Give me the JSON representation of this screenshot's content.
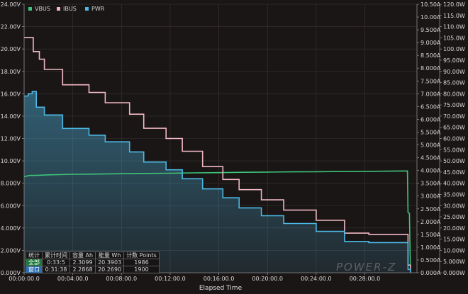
{
  "chart_data": {
    "type": "line",
    "xlabel": "Elapsed Time",
    "x_ticks": [
      "00:00:00.0",
      "00:04:00.0",
      "00:08:00.0",
      "00:12:00.0",
      "00:16:00.0",
      "00:20:00.0",
      "00:24:00.0",
      "00:28:00.0"
    ],
    "xlim_seconds": [
      0,
      1937
    ],
    "ylim_voltage": [
      0,
      24
    ],
    "ylim_current": [
      0,
      10.5
    ],
    "ylim_power": [
      0,
      120
    ],
    "y_ticks_voltage": [
      "0.000V",
      "2.000V",
      "4.000V",
      "6.000V",
      "8.000V",
      "10.00V",
      "12.00V",
      "14.00V",
      "16.00V",
      "18.00V",
      "20.00V",
      "22.00V",
      "24.00V"
    ],
    "y_ticks_current": [
      "0.000A",
      "0.500A",
      "1.000A",
      "1.500A",
      "2.000A",
      "2.500A",
      "3.000A",
      "3.500A",
      "4.000A",
      "4.500A",
      "5.000A",
      "5.500A",
      "6.000A",
      "6.500A",
      "7.000A",
      "7.500A",
      "8.000A",
      "8.500A",
      "9.000A",
      "9.500A",
      "10.00A",
      "10.50A"
    ],
    "y_ticks_power": [
      "0.000W",
      "5.000W",
      "10.00W",
      "15.00W",
      "20.00W",
      "25.00W",
      "30.00W",
      "35.00W",
      "40.00W",
      "45.00W",
      "50.00W",
      "55.00W",
      "60.00W",
      "65.00W",
      "70.00W",
      "75.00W",
      "80.00W",
      "85.00W",
      "90.00W",
      "95.00W",
      "100.0W",
      "105.0W",
      "110.0W",
      "115.0W",
      "120.0W"
    ],
    "grid": true,
    "legend_position": "top-left",
    "series": [
      {
        "name": "VBUS",
        "axis": "voltage",
        "color": "#3ec47a",
        "x": [
          0,
          30,
          60,
          120,
          240,
          360,
          480,
          600,
          720,
          840,
          960,
          1080,
          1200,
          1320,
          1440,
          1560,
          1680,
          1800,
          1890,
          1893,
          1900,
          1905
        ],
        "y": [
          8.6,
          8.7,
          8.7,
          8.75,
          8.8,
          8.82,
          8.85,
          8.88,
          8.9,
          8.93,
          8.95,
          8.98,
          9.0,
          9.02,
          9.03,
          9.05,
          9.06,
          9.08,
          9.1,
          5.4,
          5.3,
          0.05
        ]
      },
      {
        "name": "IBUS",
        "axis": "current",
        "color": "#f0b8c4",
        "x": [
          0,
          45,
          75,
          100,
          190,
          320,
          400,
          520,
          590,
          700,
          780,
          880,
          980,
          1060,
          1170,
          1280,
          1440,
          1580,
          1700,
          1890,
          1893,
          1905
        ],
        "y": [
          9.2,
          8.65,
          8.35,
          7.95,
          7.35,
          7.05,
          6.65,
          6.2,
          5.65,
          5.25,
          4.75,
          4.15,
          3.65,
          3.25,
          2.85,
          2.45,
          2.05,
          1.55,
          1.5,
          1.5,
          0.3,
          0.03
        ]
      },
      {
        "name": "PWR",
        "axis": "power",
        "color": "#4cb9e6",
        "x": [
          0,
          20,
          40,
          60,
          100,
          190,
          320,
          400,
          520,
          590,
          700,
          780,
          880,
          980,
          1060,
          1170,
          1280,
          1440,
          1580,
          1700,
          1890,
          1893,
          1905
        ],
        "y": [
          79,
          80,
          81,
          74,
          70.5,
          64.5,
          61.5,
          58.5,
          54,
          49.5,
          46,
          42,
          37.5,
          33.5,
          29,
          25.5,
          22,
          18.5,
          14,
          13.5,
          13.5,
          1.5,
          0.05
        ]
      }
    ]
  },
  "stats_table": {
    "headers": [
      "统计",
      "累计时间",
      "容量 Ah",
      "能量 Wh",
      "计数 Points"
    ],
    "rows": [
      [
        "全部",
        "0:33:5",
        "2.3099",
        "20.3903",
        "1986"
      ],
      [
        "窗口",
        "0:31:38",
        "2.2868",
        "20.2690",
        "1900"
      ]
    ]
  },
  "logo_text": "POWER-Z"
}
